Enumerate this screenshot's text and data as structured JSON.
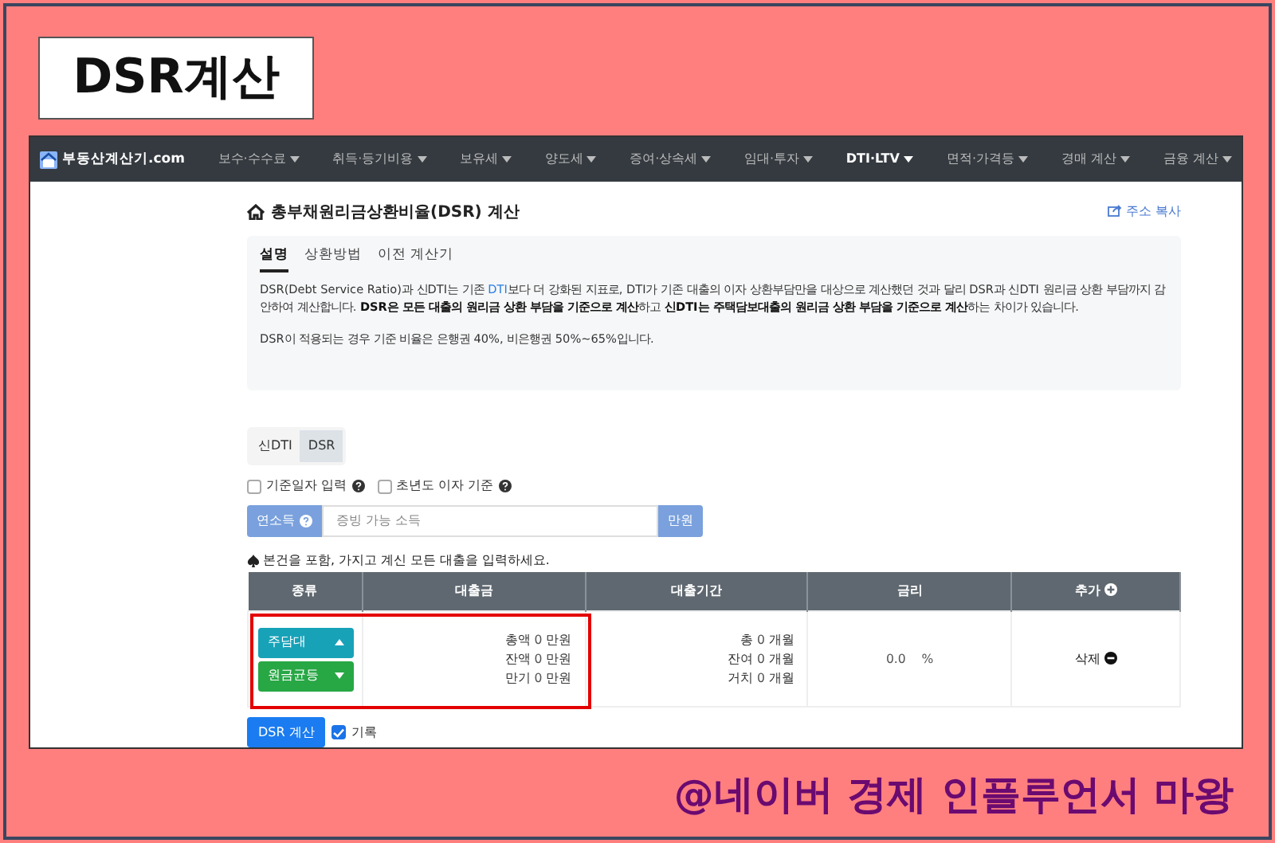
{
  "slide_title": "DSR계산",
  "navbar": {
    "brand": "부동산계산기.com",
    "items": [
      {
        "label": "보수·수수료",
        "selected": false
      },
      {
        "label": "취득·등기비용",
        "selected": false
      },
      {
        "label": "보유세",
        "selected": false
      },
      {
        "label": "양도세",
        "selected": false
      },
      {
        "label": "증여·상속세",
        "selected": false
      },
      {
        "label": "임대·투자",
        "selected": false
      },
      {
        "label": "DTI·LTV",
        "selected": true
      },
      {
        "label": "면적·가격등",
        "selected": false
      },
      {
        "label": "경매 계산",
        "selected": false
      },
      {
        "label": "금융 계산",
        "selected": false
      }
    ]
  },
  "page": {
    "heading": "총부채원리금상환비율(DSR) 계산",
    "share_link": "주소 복사",
    "info_tabs": [
      {
        "label": "설명",
        "selected": true
      },
      {
        "label": "상환방법",
        "selected": false
      },
      {
        "label": "이전 계산기",
        "selected": false
      }
    ],
    "paragraphs": [
      {
        "before": "DSR(Debt Service Ratio)과 신DTI는 기존 ",
        "link": "DTI",
        "after": "보다 더 강화된 지표로, DTI가 기존 대출의 이자 상환부담만을 대상으로 계산했던 것과 달리 DSR과 신DTI 원리금 상환 부담까지 감안하여 계산합니다. **DSR은 모든 대출의 원리금 상환 부담을 기준으로 계산**하고 **신DTI는 주택담보대출의 원리금 상환 부담을 기준으로 계산**하는 차이가 있습니다."
      },
      {
        "before": "DSR이 적용되는 경우 기준 비율은 은행권 40%, 비은행권 50%~65%입니다."
      }
    ],
    "mode_tabs": [
      {
        "label": "신DTI",
        "selected": false
      },
      {
        "label": "DSR",
        "selected": true
      }
    ],
    "options": [
      {
        "label": "기준일자 입력",
        "checked": false
      },
      {
        "label": "초년도 이자 기준",
        "checked": false
      }
    ],
    "income": {
      "label": "연소득",
      "placeholder": "증빙 가능 소득",
      "unit": "만원"
    },
    "note": "본건을 포함, 가지고 계신 모든 대출을 입력하세요.",
    "table": {
      "columns": [
        "종류",
        "대출금",
        "대출기간",
        "금리",
        "추가"
      ],
      "rows": [
        {
          "loan_type": "주담대",
          "repayment": "원금균등",
          "amounts": [
            {
              "label": "총액",
              "value": "0",
              "unit": "만원"
            },
            {
              "label": "잔액",
              "value": "0",
              "unit": "만원"
            },
            {
              "label": "만기",
              "value": "0",
              "unit": "만원"
            }
          ],
          "periods": [
            {
              "label": "총",
              "value": "0",
              "unit": "개월"
            },
            {
              "label": "잔여",
              "value": "0",
              "unit": "개월"
            },
            {
              "label": "거치",
              "value": "0",
              "unit": "개월"
            }
          ],
          "rate": "0.0",
          "rate_unit": "%",
          "delete": "삭제"
        }
      ]
    },
    "submit": "DSR 계산",
    "record": {
      "label": "기록",
      "checked": true
    }
  },
  "credit": "@네이버 경제 인플루언서 마왕"
}
